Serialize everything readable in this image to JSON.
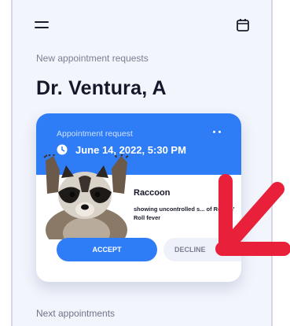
{
  "header": {
    "menu_icon": "hamburger-menu-icon",
    "calendar_icon": "calendar-icon"
  },
  "subtitle": "New appointment requests",
  "doctor_name": "Dr. Ventura, A",
  "request_card": {
    "label": "Appointment request",
    "more_icon": "more-dots-icon",
    "date_icon": "clock-icon",
    "date": "June 14, 2022, 5:30 PM",
    "pet_name": "Raccoon",
    "description": "showing uncontrolled s... of Rock n' Roll fever",
    "accept_label": "ACCEPT",
    "decline_label": "DECLINE",
    "colors": {
      "accent": "#2f7df6",
      "decline_bg": "#eef1fa",
      "annotation_arrow": "#e8203a"
    }
  },
  "next_section_label": "Next appointments"
}
